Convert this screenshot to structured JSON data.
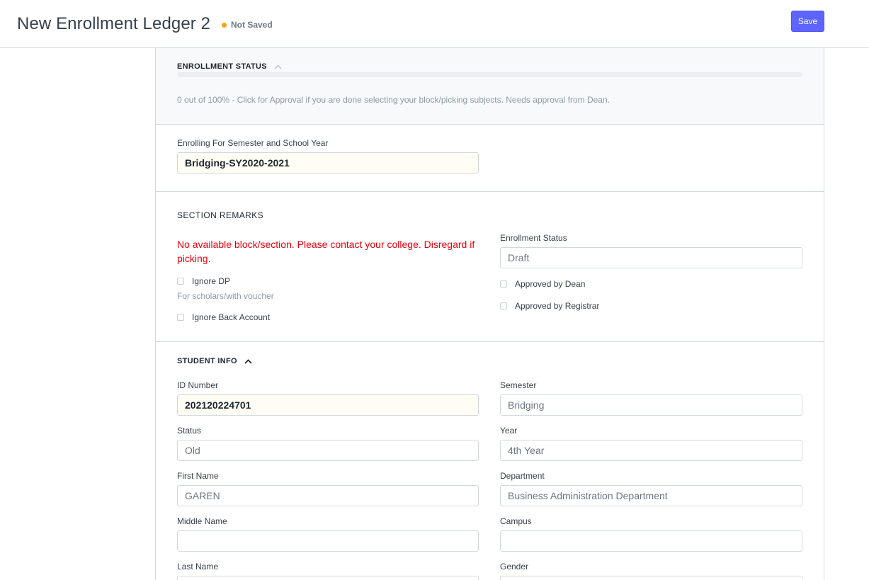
{
  "header": {
    "title": "New Enrollment Ledger 2",
    "indicator": "Not Saved",
    "indicator_color": "#ffa00a",
    "save_label": "Save"
  },
  "enrollment_status_section": {
    "title": "ENROLLMENT STATUS",
    "progress_fraction": 0,
    "help_text": "0 out of 100% - Click for Approval if you are done selecting your block/picking subjects. Needs approval from Dean."
  },
  "enrolling": {
    "label": "Enrolling For Semester and School Year",
    "value": "Bridging-SY2020-2021"
  },
  "section_remarks": {
    "title": "SECTION REMARKS",
    "message": "No available block/section. Please contact your college. Disregard if picking.",
    "ignore_dp_label": "Ignore DP",
    "ignore_dp_help": "For scholars/with voucher",
    "ignore_back_account_label": "Ignore Back Account",
    "enrollment_status_label": "Enrollment Status",
    "enrollment_status_value": "Draft",
    "approved_by_dean_label": "Approved by Dean",
    "approved_by_registrar_label": "Approved by Registrar"
  },
  "student_info": {
    "title": "STUDENT INFO",
    "id_number_label": "ID Number",
    "id_number_value": "202120224701",
    "status_label": "Status",
    "status_value": "Old",
    "first_name_label": "First Name",
    "first_name_value": "GAREN",
    "middle_name_label": "Middle Name",
    "middle_name_value": "",
    "last_name_label": "Last Name",
    "last_name_value": "",
    "semester_label": "Semester",
    "semester_value": "Bridging",
    "year_label": "Year",
    "year_value": "4th Year",
    "department_label": "Department",
    "department_value": "Business Administration Department",
    "campus_label": "Campus",
    "campus_value": "",
    "gender_label": "Gender",
    "gender_value": ""
  },
  "icons": {
    "chevron_up": "chevron-up-icon"
  }
}
